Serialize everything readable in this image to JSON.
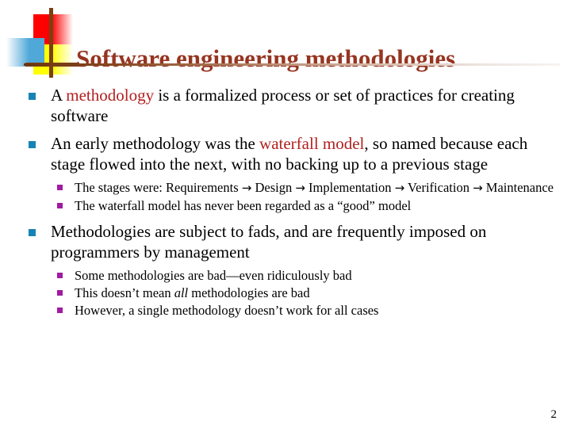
{
  "slide": {
    "title": "Software engineering methodologies",
    "page_number": "2",
    "colors": {
      "title": "#963521",
      "accent_text": "#b32020",
      "bullet_level1": "#1583b4",
      "bullet_level2": "#a11aa1",
      "logo_red": "#fe0000",
      "logo_yellow": "#ffff00",
      "logo_blue": "#4fa8d8",
      "logo_bar": "#7b3f10"
    }
  },
  "bullets": [
    {
      "id": "b1",
      "parts": [
        {
          "text": "A ",
          "style": "plain"
        },
        {
          "text": "methodology",
          "style": "accent"
        },
        {
          "text": " is a formalized process or set of practices for creating software",
          "style": "plain"
        }
      ],
      "children": []
    },
    {
      "id": "b2",
      "parts": [
        {
          "text": "An early methodology was the ",
          "style": "plain"
        },
        {
          "text": "waterfall model",
          "style": "accent"
        },
        {
          "text": ", so named because each stage flowed into the next, with no backing up to a previous stage",
          "style": "plain"
        }
      ],
      "children": [
        {
          "id": "b2s1",
          "parts": [
            {
              "text": "The stages were: Requirements ",
              "style": "plain"
            },
            {
              "text": "→",
              "style": "arrow"
            },
            {
              "text": " Design ",
              "style": "plain"
            },
            {
              "text": "→",
              "style": "arrow"
            },
            {
              "text": " Implementation ",
              "style": "plain"
            },
            {
              "text": "→",
              "style": "arrow"
            },
            {
              "text": " Verification ",
              "style": "plain"
            },
            {
              "text": "→",
              "style": "arrow"
            },
            {
              "text": " Maintenance",
              "style": "plain"
            }
          ]
        },
        {
          "id": "b2s2",
          "parts": [
            {
              "text": "The waterfall model has never been regarded as a “good” model",
              "style": "plain"
            }
          ]
        }
      ]
    },
    {
      "id": "b3",
      "parts": [
        {
          "text": "Methodologies are subject to fads, and are frequently imposed on programmers by management",
          "style": "plain"
        }
      ],
      "children": [
        {
          "id": "b3s1",
          "parts": [
            {
              "text": "Some methodologies are bad—even ridiculously bad",
              "style": "plain"
            }
          ]
        },
        {
          "id": "b3s2",
          "parts": [
            {
              "text": "This doesn’t mean ",
              "style": "plain"
            },
            {
              "text": "all",
              "style": "italic"
            },
            {
              "text": " methodologies are bad",
              "style": "plain"
            }
          ]
        },
        {
          "id": "b3s3",
          "parts": [
            {
              "text": "However, a single methodology doesn’t work for all cases",
              "style": "plain"
            }
          ]
        }
      ]
    }
  ]
}
